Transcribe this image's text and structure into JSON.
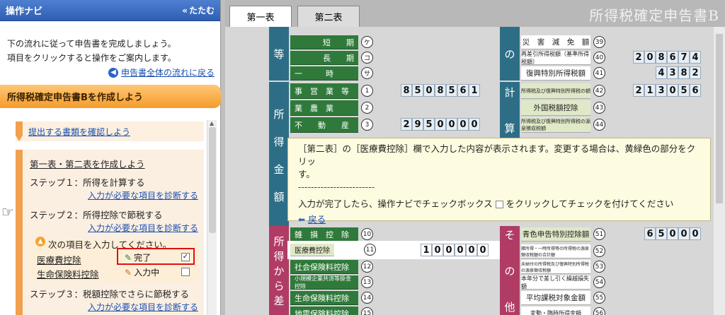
{
  "navi": {
    "title": "操作ナビ",
    "collapse_label": "たたむ",
    "intro_line1": "下の流れに従って申告書を完成しましょう。",
    "intro_line2": "項目をクリックすると操作をご案内します。",
    "back_to_flow": "申告書全体の流れに戻る",
    "section_title": "所得税確定申告書Bを作成しよう",
    "check_docs_link": "提出する書類を確認しよう",
    "create_tables_link": "第一表・第二表を作成しよう",
    "step1": "ステップ１：所得を計算する",
    "step2": "ステップ２：所得控除で節税する",
    "step3": "ステップ３：税額控除でさらに節税する",
    "diagnose_link": "入力が必要な項目を診断する",
    "sub_instruction": "次の項目を入力してください。",
    "items": [
      {
        "label": "医療費控除",
        "status": "完了",
        "checked": "✓"
      },
      {
        "label": "生命保険料控除",
        "status": "入力中",
        "checked": ""
      }
    ]
  },
  "tabs": [
    "第一表",
    "第二表"
  ],
  "doc_title": "所得税確定申告書B",
  "form": {
    "left_rows": [
      {
        "label": "短　　期",
        "circle": "ケ"
      },
      {
        "label": "長　　期",
        "circle": "コ"
      },
      {
        "label": "一　　　時",
        "circle": "サ"
      },
      {
        "label": "事　営　業　等",
        "circle": "1",
        "value": "850856 1"
      },
      {
        "label": "業　農　業",
        "circle": "2"
      },
      {
        "label": "不　　動　　産",
        "circle": "3",
        "value": "2950000"
      },
      {
        "label": "雑　損　控　除",
        "circle": "10"
      },
      {
        "label": "医療費控除",
        "circle": "11",
        "value": "100000"
      },
      {
        "label": "社会保険料控除",
        "circle": "12"
      },
      {
        "label": "小規模企業共済等掛金控除",
        "circle": "13"
      },
      {
        "label": "生命保険料控除",
        "circle": "14"
      },
      {
        "label": "地震保険料控除",
        "circle": "15"
      }
    ],
    "vcols": [
      "等",
      "所",
      "得",
      "金",
      "額",
      "所",
      "得",
      "か",
      "ら",
      "差"
    ],
    "right_rows": [
      {
        "label": "災　害　減　免　額",
        "circle": "39"
      },
      {
        "label": "再差引所得税額（基準所得税額）",
        "circle": "40",
        "value": "208674"
      },
      {
        "label": "復興特別所得税額",
        "circle": "41",
        "value": "4382"
      },
      {
        "label": "所得税及び復興特別所得税の額",
        "circle": "42",
        "value": "213056"
      },
      {
        "label": "外国税額控除",
        "circle": "43"
      },
      {
        "label": "所得税及び復興特別所得税の源泉徴収税額",
        "circle": "44"
      },
      {
        "label": "青色申告特別控除額",
        "circle": "51",
        "value": "65000"
      },
      {
        "label": "雑所得・一時所得等の所得税の源泉徴収税額の合計額",
        "circle": "52"
      },
      {
        "label": "未納付の所得税及び復興特別所得税の源泉徴収税額",
        "circle": "53"
      },
      {
        "label": "本年分で差し引く繰越損失額",
        "circle": "54"
      },
      {
        "label": "平均課税対象金額",
        "circle": "55"
      },
      {
        "label": "変動・臨時所得金額",
        "circle": "56"
      }
    ],
    "right_vcols": [
      "の",
      "計",
      "算",
      "そ",
      "の",
      "他"
    ]
  },
  "popup": {
    "line1": "［第二表］の［医療費控除］欄で入力した内容が表示されます。変更する場合は、黄緑色の部分をクリッ",
    "line2": "す。",
    "dashes": "------------------------",
    "line3": "入力が完了したら、操作ナビでチェックボックス",
    "line3b": "をクリックしてチェックを付けてください",
    "back": "戻る"
  }
}
